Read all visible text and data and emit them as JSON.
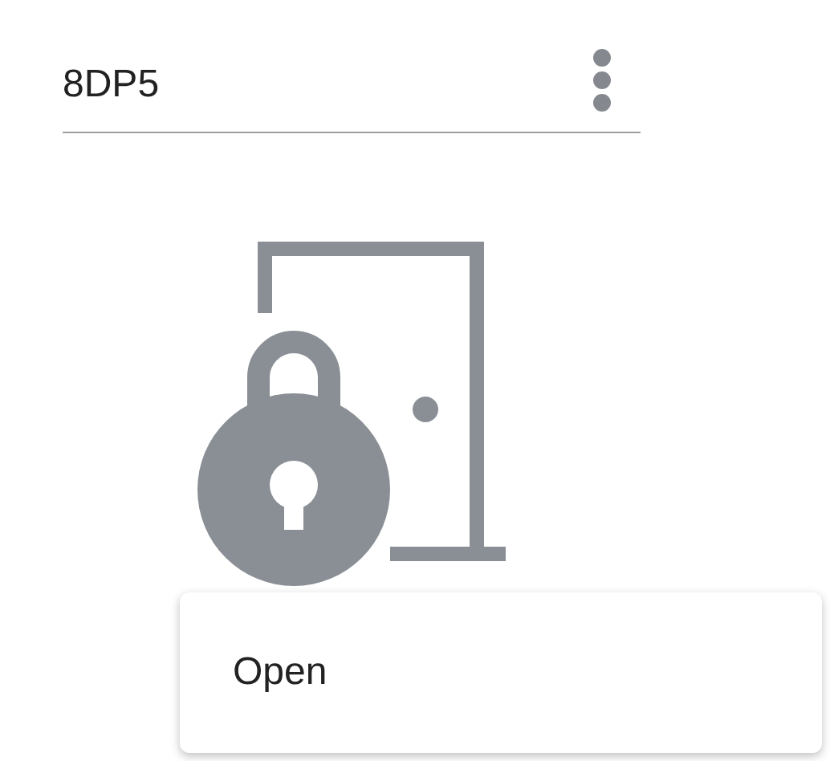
{
  "title": "8DP5",
  "menu_items": [
    {
      "label": "Open"
    }
  ]
}
